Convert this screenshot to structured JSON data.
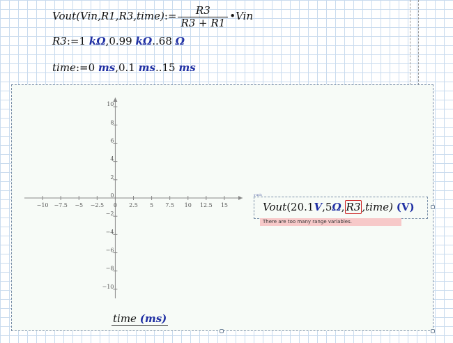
{
  "worksheet": {
    "def_vout": {
      "fn": "Vout",
      "args": "(Vin,R1,R3,time)",
      "assign": ":=",
      "numerator": "R3",
      "denominator": "R3 + R1",
      "tail": "•Vin"
    },
    "def_r3": {
      "lhs": "R3",
      "assign": ":=",
      "v1": "1",
      "u1": "kΩ",
      "v2": ",0.99",
      "u2": "kΩ",
      "v3": "..68",
      "u3": "Ω"
    },
    "def_time": {
      "lhs": "time",
      "assign": ":=",
      "v1": "0",
      "u1": "ms",
      "v2": ",0.1",
      "u2": "ms",
      "v3": "..15",
      "u3": "ms"
    }
  },
  "plot": {
    "x_axis_label": "time",
    "x_axis_unit": "(ms)",
    "y_expression": {
      "fn": "Vout",
      "open": "(20.1",
      "u1": "V",
      "a2": ",5",
      "u2": "Ω",
      "a3": ",",
      "boxed": "R3",
      "a4": ",time)",
      "unit": "(V)"
    },
    "y_axis_tag": "y-axis",
    "error_message": "There are too many range variables."
  },
  "chart_data": {
    "type": "line",
    "xlim": [
      -12.5,
      17.5
    ],
    "ylim": [
      -11,
      11
    ],
    "x_ticks": [
      "-10",
      "-7.5",
      "-5",
      "-2.5",
      "0",
      "2.5",
      "5",
      "7.5",
      "10",
      "12.5",
      "15"
    ],
    "y_ticks": [
      "10",
      "8",
      "6",
      "4",
      "2",
      "0",
      "-2",
      "-4",
      "-6",
      "-8",
      "-10"
    ],
    "grid": false,
    "series": []
  }
}
